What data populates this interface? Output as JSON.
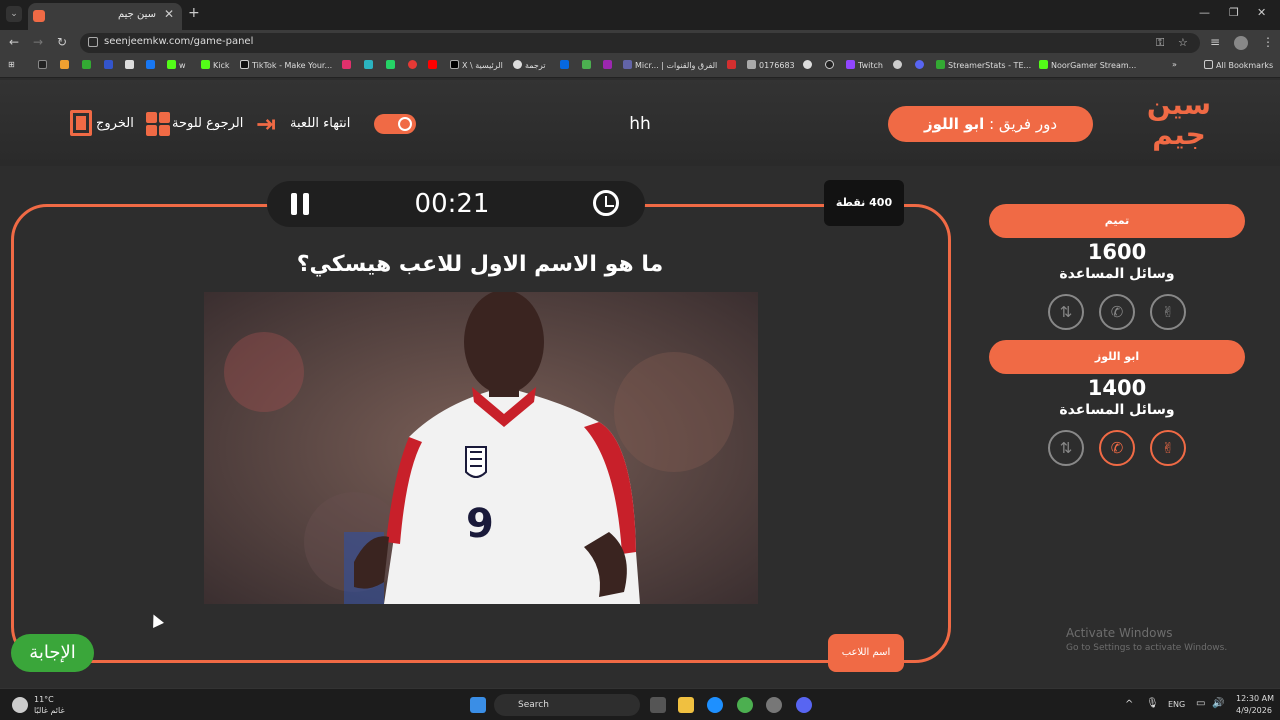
{
  "browser": {
    "tab_title": "سين جيم",
    "url": "seenjeemkw.com/game-panel",
    "bookmarks": [
      "w",
      "Kick",
      "TikTok - Make Your...",
      "X \\ الرئيسية",
      "ترجمة",
      "Micr... | الفرق والقنوات",
      "0176683",
      "Twitch",
      "StreamerStats - TE...",
      "NoorGamer Stream...",
      "All Bookmarks"
    ]
  },
  "header": {
    "logo_text": "سين جيم",
    "turn_label": "دور فريق :",
    "turn_team": "ابو اللوز",
    "game_name": "hh",
    "end_game": "انتهاء اللعبة",
    "back_to_board": "الرجوع للوحة",
    "exit": "الخروج"
  },
  "question_panel": {
    "timer": "00:21",
    "points": "400 نقطة",
    "question": "ما هو الاسم الاول للاعب هيسكي؟",
    "answer_button": "الإجابة",
    "category_button": "اسم اللاعب"
  },
  "teams": [
    {
      "name": "تميم",
      "score": "1600",
      "aids_label": "وسائل المساعدة"
    },
    {
      "name": "ابو اللوز",
      "score": "1400",
      "aids_label": "وسائل المساعدة"
    }
  ],
  "os": {
    "activate_title": "Activate Windows",
    "activate_sub": "Go to Settings to activate Windows.",
    "weather_temp": "11°C",
    "weather_desc": "غائم غالبًا",
    "search": "Search",
    "lang": "ENG",
    "time": "12:30 AM",
    "date": "4/9/2026"
  }
}
